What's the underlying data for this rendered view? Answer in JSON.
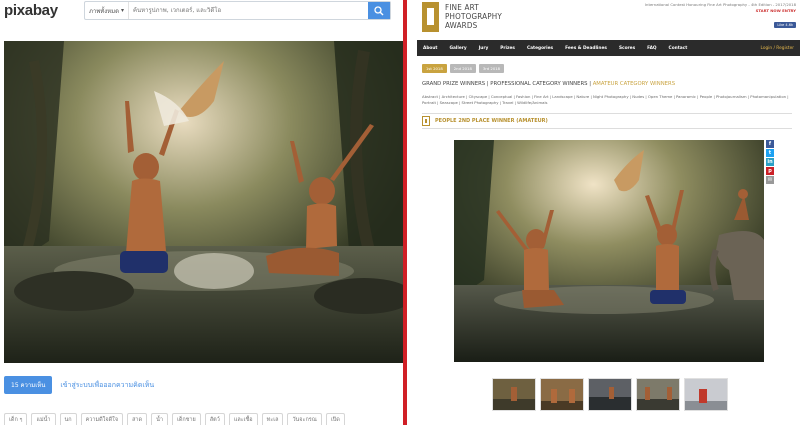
{
  "left": {
    "logo": "pixabay",
    "search": {
      "category": "ภาพทั้งหมด",
      "placeholder": "ค้นหารูปภาพ, เวกเตอร์, และวิดีโอ"
    },
    "comments": {
      "count_label": "15 ความเห็น",
      "login_prompt": "เข้าสู่ระบบเพื่อออกความคิดเห็น"
    },
    "tags": [
      "เด็ก ๆ",
      "แม่น้ำ",
      "นก",
      "ความดีใจดีใจ",
      "สาด",
      "น้ำ",
      "เด็กชาย",
      "สัตว์",
      "และเชื้อ",
      "ทะเล",
      "วันจะกรณ",
      "เปิด"
    ]
  },
  "right": {
    "logo_lines": [
      "FINE ART",
      "PHOTOGRAPHY",
      "AWARDS"
    ],
    "top_info": "International Contest Honouring Fine Art Photography - 4th Edition - 2017/2018",
    "top_info_link": "START NOW ENTRY",
    "like_label": "Like 4.6k",
    "nav": [
      "About",
      "Gallery",
      "Jury",
      "Prizes",
      "Categories",
      "Fees & Deadlines",
      "Scores",
      "FAQ",
      "Contact"
    ],
    "nav_login": "Login / Register",
    "years": [
      {
        "label": "1st 2018",
        "active": true
      },
      {
        "label": "2nd 2018",
        "active": false
      },
      {
        "label": "3rd 2018",
        "active": false
      }
    ],
    "category_title_main": "GRAND PRIZE WINNERS | PROFESSIONAL CATEGORY WINNERS | ",
    "category_title_amateur": "AMATEUR CATEGORY WINNERS",
    "category_list": "Abstract | Architecture | Cityscape | Conceptual | Fashion | Fine Art | Landscape | Nature | Night Photography | Nudes | Open Theme | Panoramic | People | Photojournalism | Photomanipulation | Portrait | Seascape | Street Photography | Travel | Wildlife/Animals",
    "winner_label": "PEOPLE 2ND PLACE WINNER (AMATEUR)"
  }
}
